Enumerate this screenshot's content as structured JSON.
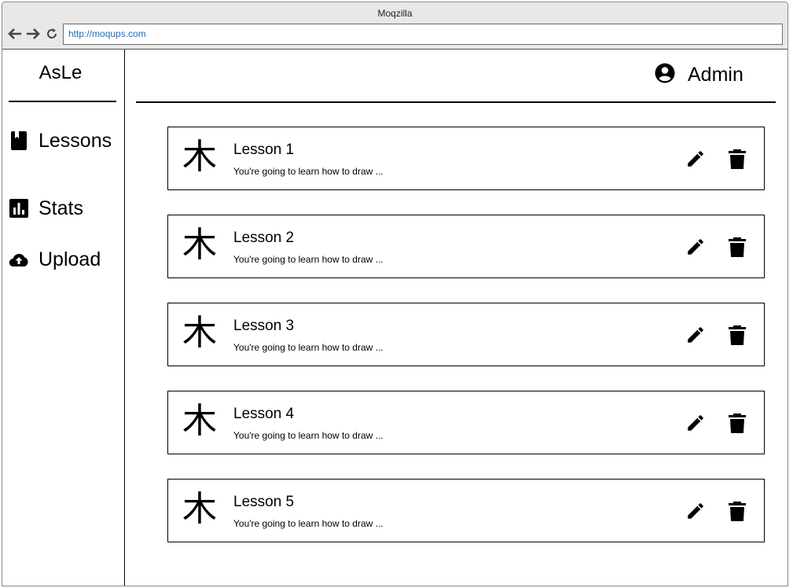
{
  "browser": {
    "window_title": "Moqzilla",
    "url": "http://moqups.com",
    "icons": [
      "back-arrow-icon",
      "forward-arrow-icon",
      "reload-icon"
    ]
  },
  "sidebar": {
    "brand": "AsLe",
    "items": [
      {
        "label": "Lessons",
        "icon": "book-icon"
      },
      {
        "label": "Stats",
        "icon": "bar-chart-icon"
      },
      {
        "label": "Upload",
        "icon": "cloud-upload-icon"
      }
    ]
  },
  "header": {
    "user_label": "Admin",
    "user_icon": "account-circle-icon"
  },
  "lessons": [
    {
      "glyph": "木",
      "title": "Lesson 1",
      "desc": "You're going to learn how to draw ..."
    },
    {
      "glyph": "木",
      "title": "Lesson 2",
      "desc": "You're going to learn how to draw ..."
    },
    {
      "glyph": "木",
      "title": "Lesson 3",
      "desc": "You're going to learn how to draw ..."
    },
    {
      "glyph": "木",
      "title": "Lesson 4",
      "desc": "You're going to learn how to draw ..."
    },
    {
      "glyph": "木",
      "title": "Lesson 5",
      "desc": "You're going to learn how to draw ..."
    }
  ],
  "lesson_actions": [
    "pencil-icon",
    "trash-icon"
  ]
}
